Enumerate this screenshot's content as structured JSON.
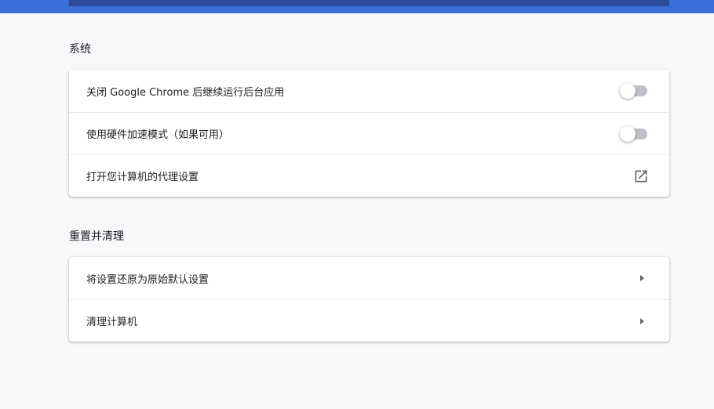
{
  "sections": [
    {
      "title": "系统",
      "rows": [
        {
          "label": "关闭 Google Chrome 后继续运行后台应用",
          "control": "toggle",
          "state": "off"
        },
        {
          "label": "使用硬件加速模式（如果可用）",
          "control": "toggle",
          "state": "off"
        },
        {
          "label": "打开您计算机的代理设置",
          "control": "external-link-icon"
        }
      ]
    },
    {
      "title": "重置并清理",
      "rows": [
        {
          "label": "将设置还原为原始默认设置",
          "control": "arrow-right-icon"
        },
        {
          "label": "清理计算机",
          "control": "arrow-right-icon"
        }
      ]
    }
  ],
  "colors": {
    "header_blue": "#3a6fd8",
    "header_dark": "#2a4a9c",
    "page_bg": "#f7f8fa",
    "toggle_off_track": "#bdc1c6",
    "icon": "#5f6368"
  }
}
